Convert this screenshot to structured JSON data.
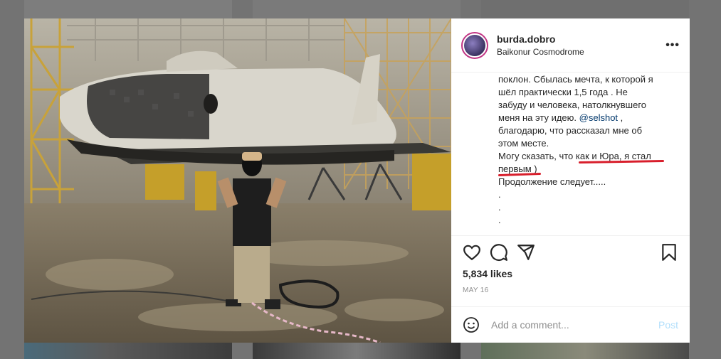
{
  "post": {
    "username": "burda.dobro",
    "location": "Baikonur Cosmodrome",
    "more_label": "•••",
    "caption_lines": [
      "поклон. Сбылась мечта, к которой я",
      "шёл практически 1,5 года . Не",
      "забуду и человека, натолкнувшего",
      "меня на эту идею."
    ],
    "mention": "@selshot",
    "caption_after_mention": " ,",
    "caption_lines2": [
      "благодарю, что рассказал мне об",
      "этом месте.",
      "Могу сказать, что как и Юра, я стал",
      "первым )",
      "Продолжение следует.....",
      ".",
      ".",
      "."
    ],
    "likes": "5,834 likes",
    "date": "MAY 16"
  },
  "comment": {
    "placeholder": "Add a comment...",
    "post_label": "Post"
  },
  "icons": {
    "like": "heart-icon",
    "comment": "comment-icon",
    "share": "share-icon",
    "save": "bookmark-icon",
    "emoji": "emoji-icon"
  },
  "colors": {
    "accent": "#0095f6",
    "post_disabled": "#b2dffc",
    "underline_annotation": "#d81e2b"
  }
}
